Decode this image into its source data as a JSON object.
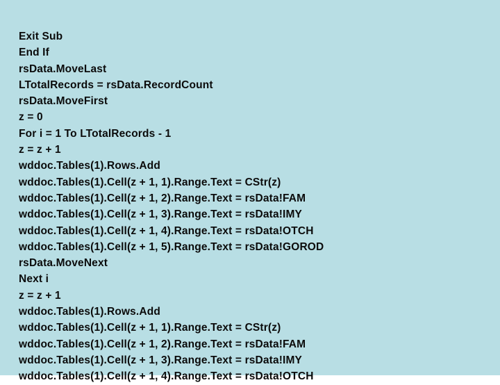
{
  "slide": {
    "background_color": "#b8dee4",
    "text_color": "#0b0b0b",
    "code_lines": [
      "Exit Sub",
      "End If",
      "rsData.MoveLast",
      "LTotalRecords = rsData.RecordCount",
      "rsData.MoveFirst",
      "z = 0",
      "For i = 1 To LTotalRecords - 1",
      "z = z + 1",
      "wddoc.Tables(1).Rows.Add",
      "wddoc.Tables(1).Cell(z + 1, 1).Range.Text = CStr(z)",
      "wddoc.Tables(1).Cell(z + 1, 2).Range.Text = rsData!FAM",
      "wddoc.Tables(1).Cell(z + 1, 3).Range.Text = rsData!IMY",
      "wddoc.Tables(1).Cell(z + 1, 4).Range.Text = rsData!OTCH",
      "wddoc.Tables(1).Cell(z + 1, 5).Range.Text = rsData!GOROD",
      "rsData.MoveNext",
      "Next i",
      "z = z + 1",
      "wddoc.Tables(1).Rows.Add",
      "wddoc.Tables(1).Cell(z + 1, 1).Range.Text = CStr(z)",
      "wddoc.Tables(1).Cell(z + 1, 2).Range.Text = rsData!FAM",
      "wddoc.Tables(1).Cell(z + 1, 3).Range.Text = rsData!IMY",
      "wddoc.Tables(1).Cell(z + 1, 4).Range.Text = rsData!OTCH"
    ]
  }
}
